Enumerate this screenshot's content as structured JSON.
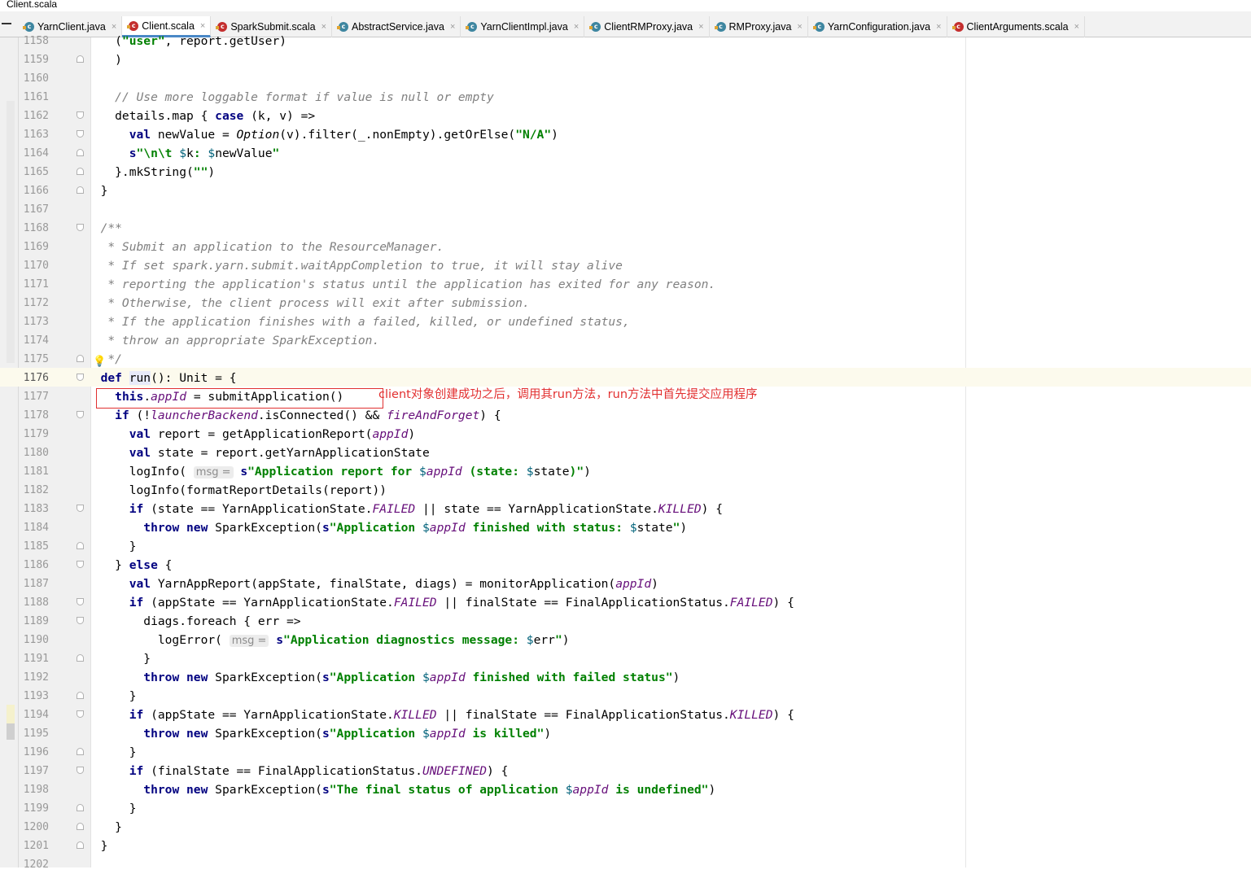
{
  "window": {
    "title": "Client.scala"
  },
  "tabs": [
    {
      "label": "YarnClient.java",
      "type": "java",
      "active": false
    },
    {
      "label": "Client.scala",
      "type": "scala",
      "active": true
    },
    {
      "label": "SparkSubmit.scala",
      "type": "scala",
      "active": false
    },
    {
      "label": "AbstractService.java",
      "type": "java",
      "active": false
    },
    {
      "label": "YarnClientImpl.java",
      "type": "java",
      "active": false
    },
    {
      "label": "ClientRMProxy.java",
      "type": "java",
      "active": false
    },
    {
      "label": "RMProxy.java",
      "type": "java",
      "active": false
    },
    {
      "label": "YarnConfiguration.java",
      "type": "java",
      "active": false
    },
    {
      "label": "ClientArguments.scala",
      "type": "scala",
      "active": false
    }
  ],
  "tab_close_glyph": "×",
  "annotation": {
    "text": "client对象创建成功之后，调用其run方法，run方法中首先提交应用程序"
  },
  "editor": {
    "current_line": "1176",
    "lines": [
      {
        "n": "1158",
        "fold": "",
        "html": "    (<span class=\"str\">\"user\"</span>, report.getUser)"
      },
      {
        "n": "1159",
        "fold": "up",
        "html": "    )"
      },
      {
        "n": "1160",
        "fold": "",
        "html": ""
      },
      {
        "n": "1161",
        "fold": "",
        "html": "    <span class=\"cmt\">// Use more loggable format if value is null or empty</span>"
      },
      {
        "n": "1162",
        "fold": "down",
        "html": "    details.map { <span class=\"kw\">case</span> (k, v) =>"
      },
      {
        "n": "1163",
        "fold": "down",
        "html": "      <span class=\"kw\">val</span> newValue = <i>Option</i>(v).filter(_.nonEmpty).getOrElse(<span class=\"str\">\"N/A\"</span>)"
      },
      {
        "n": "1164",
        "fold": "up",
        "html": "      <span class=\"kw\">s</span><span class=\"str\">\"\\n\\t </span><span style=\"color:#00627a\">$</span>k<span class=\"str\">: </span><span style=\"color:#00627a\">$</span>newValue<span class=\"str\">\"</span>"
      },
      {
        "n": "1165",
        "fold": "up",
        "html": "    }.mkString(<span class=\"str\">\"\"</span>)"
      },
      {
        "n": "1166",
        "fold": "up",
        "html": "  }"
      },
      {
        "n": "1167",
        "fold": "",
        "html": ""
      },
      {
        "n": "1168",
        "fold": "down",
        "html": "  <span class=\"cmt\">/**</span>"
      },
      {
        "n": "1169",
        "fold": "",
        "html": "  <span class=\"cmt\"> * Submit an application to the ResourceManager.</span>"
      },
      {
        "n": "1170",
        "fold": "",
        "html": "  <span class=\"cmt\"> * If set spark.yarn.submit.waitAppCompletion to true, it will stay alive</span>"
      },
      {
        "n": "1171",
        "fold": "",
        "html": "  <span class=\"cmt\"> * reporting the application's status until the application has exited for any reason.</span>"
      },
      {
        "n": "1172",
        "fold": "",
        "html": "  <span class=\"cmt\"> * Otherwise, the client process will exit after submission.</span>"
      },
      {
        "n": "1173",
        "fold": "",
        "html": "  <span class=\"cmt\"> * If the application finishes with a failed, killed, or undefined status,</span>"
      },
      {
        "n": "1174",
        "fold": "",
        "html": "  <span class=\"cmt\"> * throw an appropriate SparkException.</span>"
      },
      {
        "n": "1175",
        "fold": "up",
        "html": "  <span class=\"cmt\"> */</span>"
      },
      {
        "n": "1176",
        "fold": "down",
        "html": "  <span class=\"kw\">def</span> <span class=\"run-hl\">run</span>(): Unit = {"
      },
      {
        "n": "1177",
        "fold": "",
        "html": "    <span class=\"kw\">this</span>.<span class=\"fld\">appId</span> = submitApplication()"
      },
      {
        "n": "1178",
        "fold": "down",
        "html": "    <span class=\"kw\">if</span> (!<span class=\"fld\">launcherBackend</span>.isConnected() && <span class=\"fld\">fireAndForget</span>) {"
      },
      {
        "n": "1179",
        "fold": "",
        "html": "      <span class=\"kw\">val</span> report = getApplicationReport(<span class=\"fld\">appId</span>)"
      },
      {
        "n": "1180",
        "fold": "",
        "html": "      <span class=\"kw\">val</span> state = report.getYarnApplicationState"
      },
      {
        "n": "1181",
        "fold": "",
        "html": "      logInfo( <span class=\"hint\">msg =</span> <span class=\"kw\">s</span><span class=\"str\">\"Application report for </span><span style=\"color:#00627a\">$</span><span class=\"fld\">appId</span><span class=\"str\"> (state: </span><span style=\"color:#00627a\">$</span>state<span class=\"str\">)\"</span>)"
      },
      {
        "n": "1182",
        "fold": "",
        "html": "      logInfo(formatReportDetails(report))"
      },
      {
        "n": "1183",
        "fold": "down",
        "html": "      <span class=\"kw\">if</span> (state == YarnApplicationState.<span class=\"fld\">FAILED</span> || state == YarnApplicationState.<span class=\"fld\">KILLED</span>) {"
      },
      {
        "n": "1184",
        "fold": "",
        "html": "        <span class=\"kw\">throw new</span> SparkException(<span class=\"kw\">s</span><span class=\"str\">\"Application </span><span style=\"color:#00627a\">$</span><span class=\"fld\">appId</span><span class=\"str\"> finished with status: </span><span style=\"color:#00627a\">$</span>state<span class=\"str\">\"</span>)"
      },
      {
        "n": "1185",
        "fold": "up",
        "html": "      }"
      },
      {
        "n": "1186",
        "fold": "down",
        "html": "    } <span class=\"kw\">else</span> {"
      },
      {
        "n": "1187",
        "fold": "",
        "html": "      <span class=\"kw\">val</span> YarnAppReport(appState, finalState, diags) = monitorApplication(<span class=\"fld\">appId</span>)"
      },
      {
        "n": "1188",
        "fold": "down",
        "html": "      <span class=\"kw\">if</span> (appState == YarnApplicationState.<span class=\"fld\">FAILED</span> || finalState == FinalApplicationStatus.<span class=\"fld\">FAILED</span>) {"
      },
      {
        "n": "1189",
        "fold": "down",
        "html": "        diags.foreach { err =>"
      },
      {
        "n": "1190",
        "fold": "",
        "html": "          logError( <span class=\"hint\">msg =</span> <span class=\"kw\">s</span><span class=\"str\">\"Application diagnostics message: </span><span style=\"color:#00627a\">$</span>err<span class=\"str\">\"</span>)"
      },
      {
        "n": "1191",
        "fold": "up",
        "html": "        }"
      },
      {
        "n": "1192",
        "fold": "",
        "html": "        <span class=\"kw\">throw new</span> SparkException(<span class=\"kw\">s</span><span class=\"str\">\"Application </span><span style=\"color:#00627a\">$</span><span class=\"fld\">appId</span><span class=\"str\"> finished with failed status\"</span>)"
      },
      {
        "n": "1193",
        "fold": "up",
        "html": "      }"
      },
      {
        "n": "1194",
        "fold": "down",
        "html": "      <span class=\"kw\">if</span> (appState == YarnApplicationState.<span class=\"fld\">KILLED</span> || finalState == FinalApplicationStatus.<span class=\"fld\">KILLED</span>) {"
      },
      {
        "n": "1195",
        "fold": "",
        "html": "        <span class=\"kw\">throw new</span> SparkException(<span class=\"kw\">s</span><span class=\"str\">\"Application </span><span style=\"color:#00627a\">$</span><span class=\"fld\">appId</span><span class=\"str\"> is killed\"</span>)"
      },
      {
        "n": "1196",
        "fold": "up",
        "html": "      }"
      },
      {
        "n": "1197",
        "fold": "down",
        "html": "      <span class=\"kw\">if</span> (finalState == FinalApplicationStatus.<span class=\"fld\">UNDEFINED</span>) {"
      },
      {
        "n": "1198",
        "fold": "",
        "html": "        <span class=\"kw\">throw new</span> SparkException(<span class=\"kw\">s</span><span class=\"str\">\"The final status of application </span><span style=\"color:#00627a\">$</span><span class=\"fld\">appId</span><span class=\"str\"> is undefined\"</span>)"
      },
      {
        "n": "1199",
        "fold": "up",
        "html": "      }"
      },
      {
        "n": "1200",
        "fold": "up",
        "html": "    }"
      },
      {
        "n": "1201",
        "fold": "up",
        "html": "  }"
      },
      {
        "n": "1202",
        "fold": "",
        "html": ""
      }
    ]
  },
  "colors": {
    "keyword": "#000080",
    "string": "#008000",
    "comment": "#808080",
    "field": "#660e7a",
    "annotation": "#e23030",
    "tab_active_underline": "#4a88c7"
  },
  "icons": {
    "java_file": "class-file-icon",
    "scala_file": "scala-file-icon",
    "hint": "lightbulb-icon"
  }
}
